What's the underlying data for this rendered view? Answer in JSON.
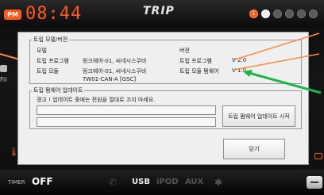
{
  "topbar": {
    "pm_label": "PM",
    "clock": "08:44",
    "title": "TRIP",
    "pager_first": "1"
  },
  "side": {
    "left_label": "Fil"
  },
  "dialog": {
    "info_group": {
      "legend": "트립 모델/버전",
      "model_header": "모델",
      "version_header": "버전",
      "rows": [
        {
          "key": "트립 프로그램",
          "value": "링크웨어-01, 씨네시스쿠비"
        },
        {
          "key": "트립 모듈",
          "value": "링크웨어-01, 씨네시스쿠비",
          "value2": "TW01-CAN-A [GSC]"
        }
      ],
      "versions": [
        {
          "key": "트립 프로그램",
          "value": "V 2.0"
        },
        {
          "key": "트립 모듈 펌웨어",
          "value": "V 1.0"
        }
      ]
    },
    "fw_group": {
      "legend": "트립 펌웨어 업데이트",
      "warning": "경고 ! 업데이트 중에는 전원을 절대로 끄지 마세요.",
      "progress_1": 0,
      "progress_2": 0,
      "start_button": "트립 펌웨어 업데이트 시작"
    },
    "close_button": "닫기"
  },
  "bottombar": {
    "timer_label": "TIMER",
    "timer_value": "OFF",
    "sources": [
      {
        "label": "USB",
        "active": true
      },
      {
        "label": "iPOD",
        "active": false
      },
      {
        "label": "AUX",
        "active": false
      }
    ]
  },
  "colors": {
    "accent": "#ff5a1a",
    "callout_orange": "#ff8a3a",
    "callout_green": "#1fb34a"
  }
}
